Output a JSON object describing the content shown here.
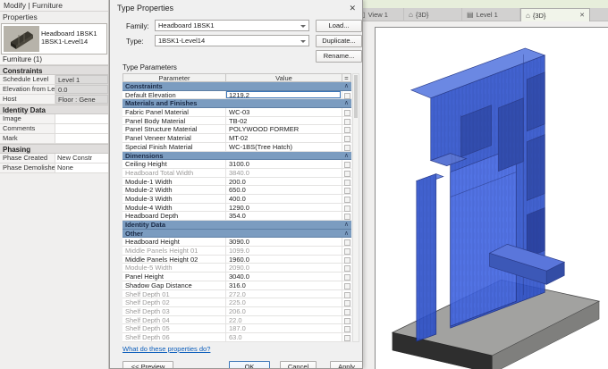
{
  "ribbon": {
    "modify_label": "Modify | Furniture"
  },
  "properties_panel": {
    "title": "Properties",
    "type_selector": {
      "family": "Headboard 1BSK1",
      "type": "1BSK1-Level14"
    },
    "filter_label": "Furniture (1)",
    "groups": [
      {
        "header": "Constraints",
        "rows": [
          {
            "label": "Schedule Level",
            "value": "Level 1",
            "muted": true
          },
          {
            "label": "Elevation from Level",
            "value": "0.0",
            "muted": true
          },
          {
            "label": "Host",
            "value": "Floor : Gene",
            "muted": true
          }
        ]
      },
      {
        "header": "Identity Data",
        "rows": [
          {
            "label": "Image",
            "value": ""
          },
          {
            "label": "Comments",
            "value": ""
          },
          {
            "label": "Mark",
            "value": ""
          }
        ]
      },
      {
        "header": "Phasing",
        "rows": [
          {
            "label": "Phase Created",
            "value": "New Constr"
          },
          {
            "label": "Phase Demolished",
            "value": "None"
          }
        ]
      }
    ]
  },
  "dialog": {
    "title": "Type Properties",
    "close_icon": "✕",
    "family_label": "Family:",
    "family_value": "Headboard 1BSK1",
    "type_label": "Type:",
    "type_value": "1BSK1-Level14",
    "load_button": "Load...",
    "duplicate_button": "Duplicate...",
    "rename_button": "Rename...",
    "type_parameters_label": "Type Parameters",
    "table": {
      "param_header": "Parameter",
      "value_header": "Value",
      "eq_header": "=",
      "rows": [
        {
          "t": "section",
          "label": "Constraints"
        },
        {
          "t": "input",
          "label": "Default Elevation",
          "value": "1219.2"
        },
        {
          "t": "section",
          "label": "Materials and Finishes"
        },
        {
          "t": "row",
          "label": "Fabric Panel Material",
          "value": "WC-03"
        },
        {
          "t": "row",
          "label": "Panel Body Material",
          "value": "TB-02"
        },
        {
          "t": "row",
          "label": "Panel Structure Material",
          "value": "POLYWOOD FORMER"
        },
        {
          "t": "row",
          "label": "Panel Veneer Material",
          "value": "MT-02"
        },
        {
          "t": "row",
          "label": "Special Finish Material",
          "value": "WC-1BS(Tree Hatch)"
        },
        {
          "t": "section",
          "label": "Dimensions"
        },
        {
          "t": "row",
          "label": "Ceiling Height",
          "value": "3100.0"
        },
        {
          "t": "row",
          "label": "Headboard Total Width",
          "value": "3840.0",
          "disabled": true
        },
        {
          "t": "row",
          "label": "Module-1 Width",
          "value": "200.0"
        },
        {
          "t": "row",
          "label": "Module-2 Width",
          "value": "650.0"
        },
        {
          "t": "row",
          "label": "Module-3 Width",
          "value": "400.0"
        },
        {
          "t": "row",
          "label": "Module-4 Width",
          "value": "1290.0"
        },
        {
          "t": "row",
          "label": "Headboard Depth",
          "value": "354.0"
        },
        {
          "t": "section",
          "label": "Identity Data"
        },
        {
          "t": "section",
          "label": "Other"
        },
        {
          "t": "row",
          "label": "Headboard Height",
          "value": "3090.0"
        },
        {
          "t": "row",
          "label": "Middle Panels Height 01",
          "value": "1099.0",
          "disabled": true
        },
        {
          "t": "row",
          "label": "Middle Panels Height 02",
          "value": "1960.0"
        },
        {
          "t": "row",
          "label": "Module-5 Width",
          "value": "2090.0",
          "disabled": true
        },
        {
          "t": "row",
          "label": "Panel Height",
          "value": "3040.0"
        },
        {
          "t": "row",
          "label": "Shadow Gap Distance",
          "value": "316.0"
        },
        {
          "t": "row",
          "label": "Shelf Depth 01",
          "value": "272.0",
          "disabled": true
        },
        {
          "t": "row",
          "label": "Shelf Depth 02",
          "value": "225.0",
          "disabled": true
        },
        {
          "t": "row",
          "label": "Shelf Depth 03",
          "value": "206.0",
          "disabled": true
        },
        {
          "t": "row",
          "label": "Shelf Depth 04",
          "value": "22.0",
          "disabled": true
        },
        {
          "t": "row",
          "label": "Shelf Depth 05",
          "value": "187.0",
          "disabled": true
        },
        {
          "t": "row",
          "label": "Shelf Depth 06",
          "value": "63.0",
          "disabled": true
        }
      ]
    },
    "help_link": "What do these properties do?",
    "preview_button": "<< Preview",
    "ok_button": "OK",
    "cancel_button": "Cancel",
    "apply_button": "Apply"
  },
  "view_tabs": [
    {
      "label": "View 1",
      "icon": "camera-view-icon",
      "active": false
    },
    {
      "label": "{3D}",
      "icon": "home-3d-icon",
      "active": false
    },
    {
      "label": "Level 1",
      "icon": "plan-view-icon",
      "active": false
    },
    {
      "label": "{3D}",
      "icon": "home-3d-icon",
      "active": true,
      "close_icon": "✕"
    }
  ],
  "colors": {
    "selection_blue": "#2e52cc",
    "section_header_blue": "#7b9cc0",
    "link_blue": "#0b5dbb",
    "ribbon_green": "#e7eedb",
    "platform_gray": "#a2a2a0"
  }
}
